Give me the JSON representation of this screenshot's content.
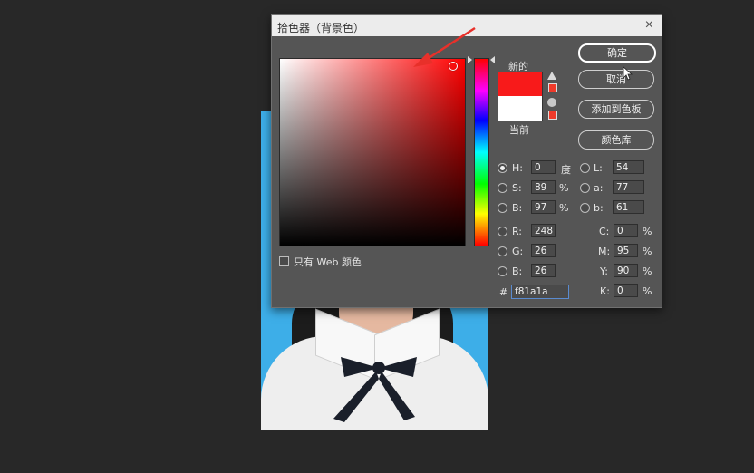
{
  "dialog": {
    "title": "拾色器（背景色）",
    "close_glyph": "×",
    "only_web_label": "只有 Web 颜色",
    "new_label": "新的",
    "current_label": "当前",
    "new_color": "#f81a1a",
    "current_color": "#ffffff"
  },
  "buttons": {
    "ok": "确定",
    "cancel": "取消",
    "add_swatch": "添加到色板",
    "color_libraries": "颜色库"
  },
  "hsb": {
    "h_label": "H:",
    "h_value": "0",
    "h_unit": "度",
    "s_label": "S:",
    "s_value": "89",
    "s_unit": "%",
    "b_label": "B:",
    "b_value": "97",
    "b_unit": "%"
  },
  "lab": {
    "l_label": "L:",
    "l_value": "54",
    "a_label": "a:",
    "a_value": "77",
    "b_label": "b:",
    "b_value": "61"
  },
  "rgb": {
    "r_label": "R:",
    "r_value": "248",
    "g_label": "G:",
    "g_value": "26",
    "b_label": "B:",
    "b_value": "26"
  },
  "cmyk": {
    "c_label": "C:",
    "c_value": "0",
    "m_label": "M:",
    "m_value": "95",
    "y_label": "Y:",
    "y_value": "90",
    "k_label": "K:",
    "k_value": "0",
    "unit": "%"
  },
  "hex": {
    "label": "#",
    "value": "f81a1a"
  },
  "colors": {
    "annotation_arrow": "#e8302a",
    "photo_background": "#3daee8"
  }
}
